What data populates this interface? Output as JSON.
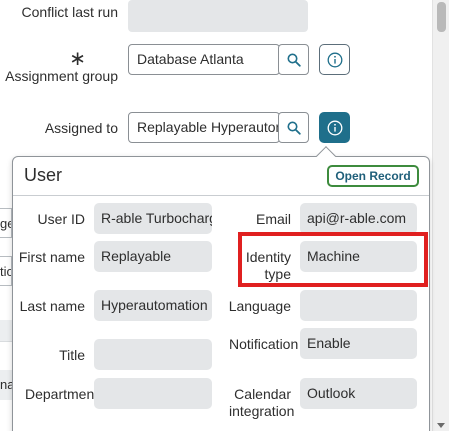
{
  "form": {
    "conflict_last_run_label": "Conflict last run",
    "assignment_group_required": "∗",
    "assignment_group_label": "Assignment group",
    "assignment_group_value": "Database Atlanta",
    "assigned_to_label": "Assigned to",
    "assigned_to_value": "Replayable Hyperautomation"
  },
  "left_fragments": {
    "frag1": "ge",
    "frag2": "tio",
    "frag3": "nat"
  },
  "popover": {
    "title": "User",
    "open_record_label": "Open Record",
    "fields": {
      "user_id": {
        "label": "User ID",
        "value": "R-able Turbocharger"
      },
      "email": {
        "label": "Email",
        "value": "api@r-able.com"
      },
      "first_name": {
        "label": "First name",
        "value": "Replayable"
      },
      "identity_type": {
        "label": "Identity type",
        "value": "Machine"
      },
      "last_name": {
        "label": "Last name",
        "value": "Hyperautomation"
      },
      "language": {
        "label": "Language",
        "value": ""
      },
      "title": {
        "label": "Title",
        "value": ""
      },
      "notification": {
        "label": "Notification",
        "value": "Enable"
      },
      "department": {
        "label": "Department",
        "value": ""
      },
      "calendar_integration": {
        "label": "Calendar integration",
        "value": "Outlook"
      }
    }
  },
  "colors": {
    "accent": "#1f6f8b",
    "open_record_border": "#3d8b3d",
    "highlight": "#e02020",
    "readonly_bg": "#e4e6e8"
  },
  "icons": {
    "search": "search-icon",
    "info": "info-icon"
  }
}
